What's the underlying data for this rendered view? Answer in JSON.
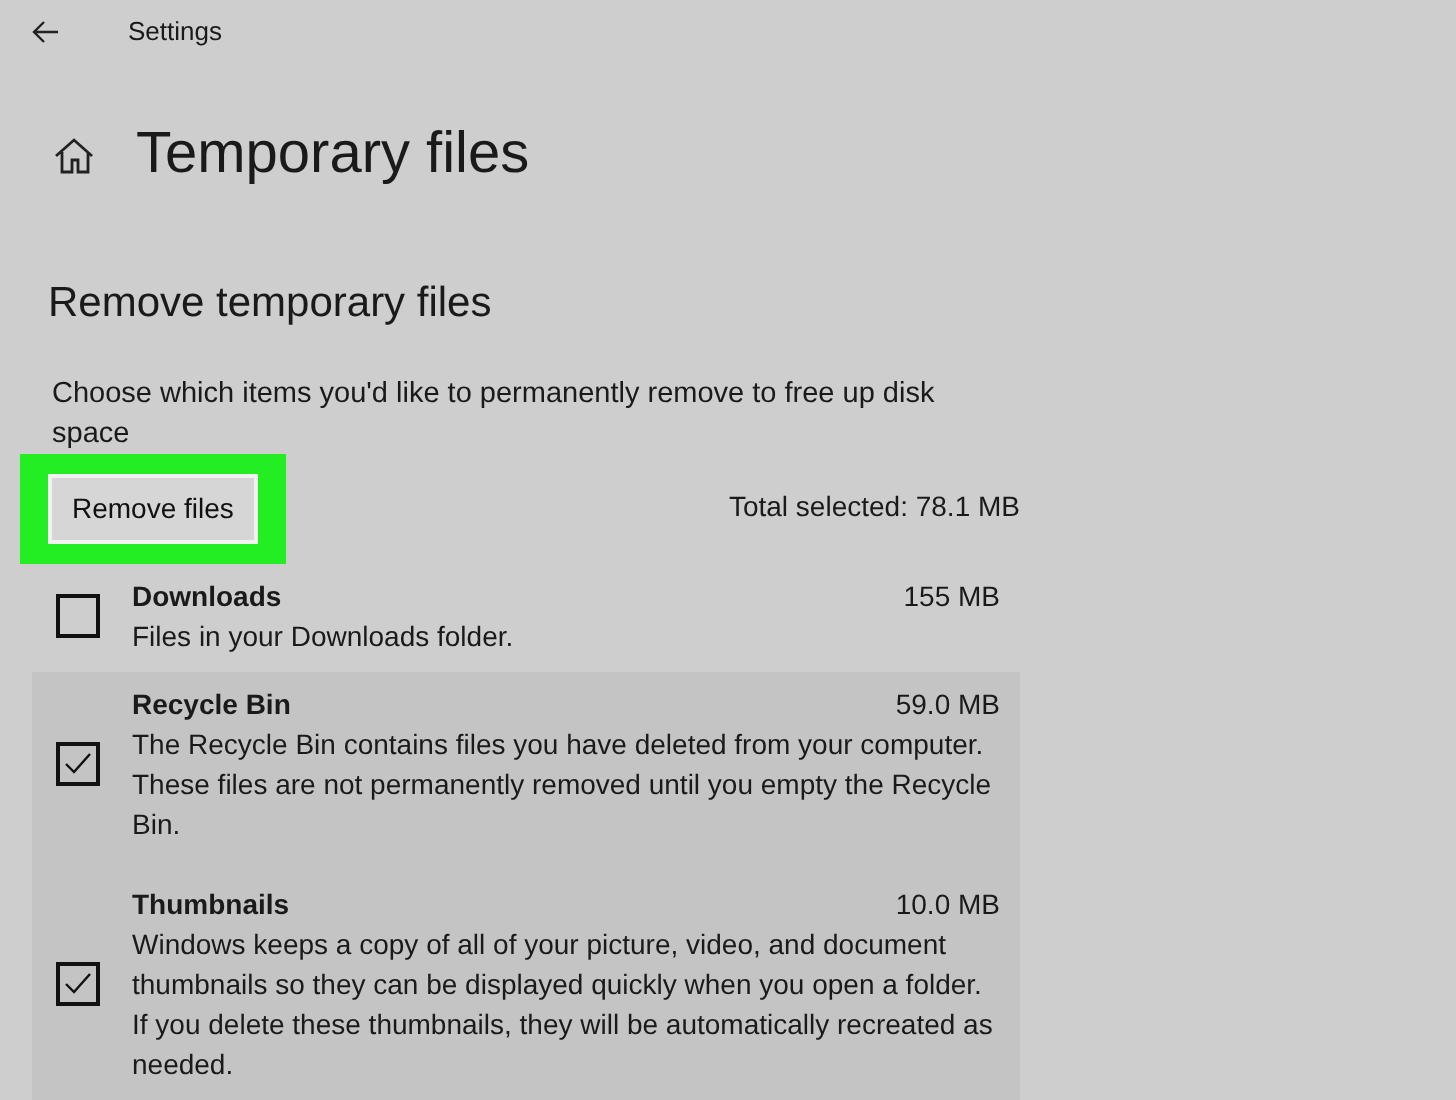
{
  "window": {
    "title": "Settings"
  },
  "page": {
    "title": "Temporary files"
  },
  "section": {
    "heading": "Remove temporary files",
    "description": "Choose which items you'd like to permanently remove to free up disk space"
  },
  "remove_button": {
    "label": "Remove files",
    "highlighted": true
  },
  "total_selected": "Total selected: 78.1 MB",
  "items": [
    {
      "name": "Downloads",
      "size": "155 MB",
      "description": "Files in your Downloads folder.",
      "checked": false
    },
    {
      "name": "Recycle Bin",
      "size": "59.0 MB",
      "description": "The Recycle Bin contains files you have deleted from your computer. These files are not permanently removed until you empty the Recycle Bin.",
      "checked": true
    },
    {
      "name": "Thumbnails",
      "size": "10.0 MB",
      "description": "Windows keeps a copy of all of your picture, video, and document thumbnails so they can be displayed quickly when you open a folder. If you delete these thumbnails, they will be automatically recreated as needed.",
      "checked": true
    }
  ]
}
